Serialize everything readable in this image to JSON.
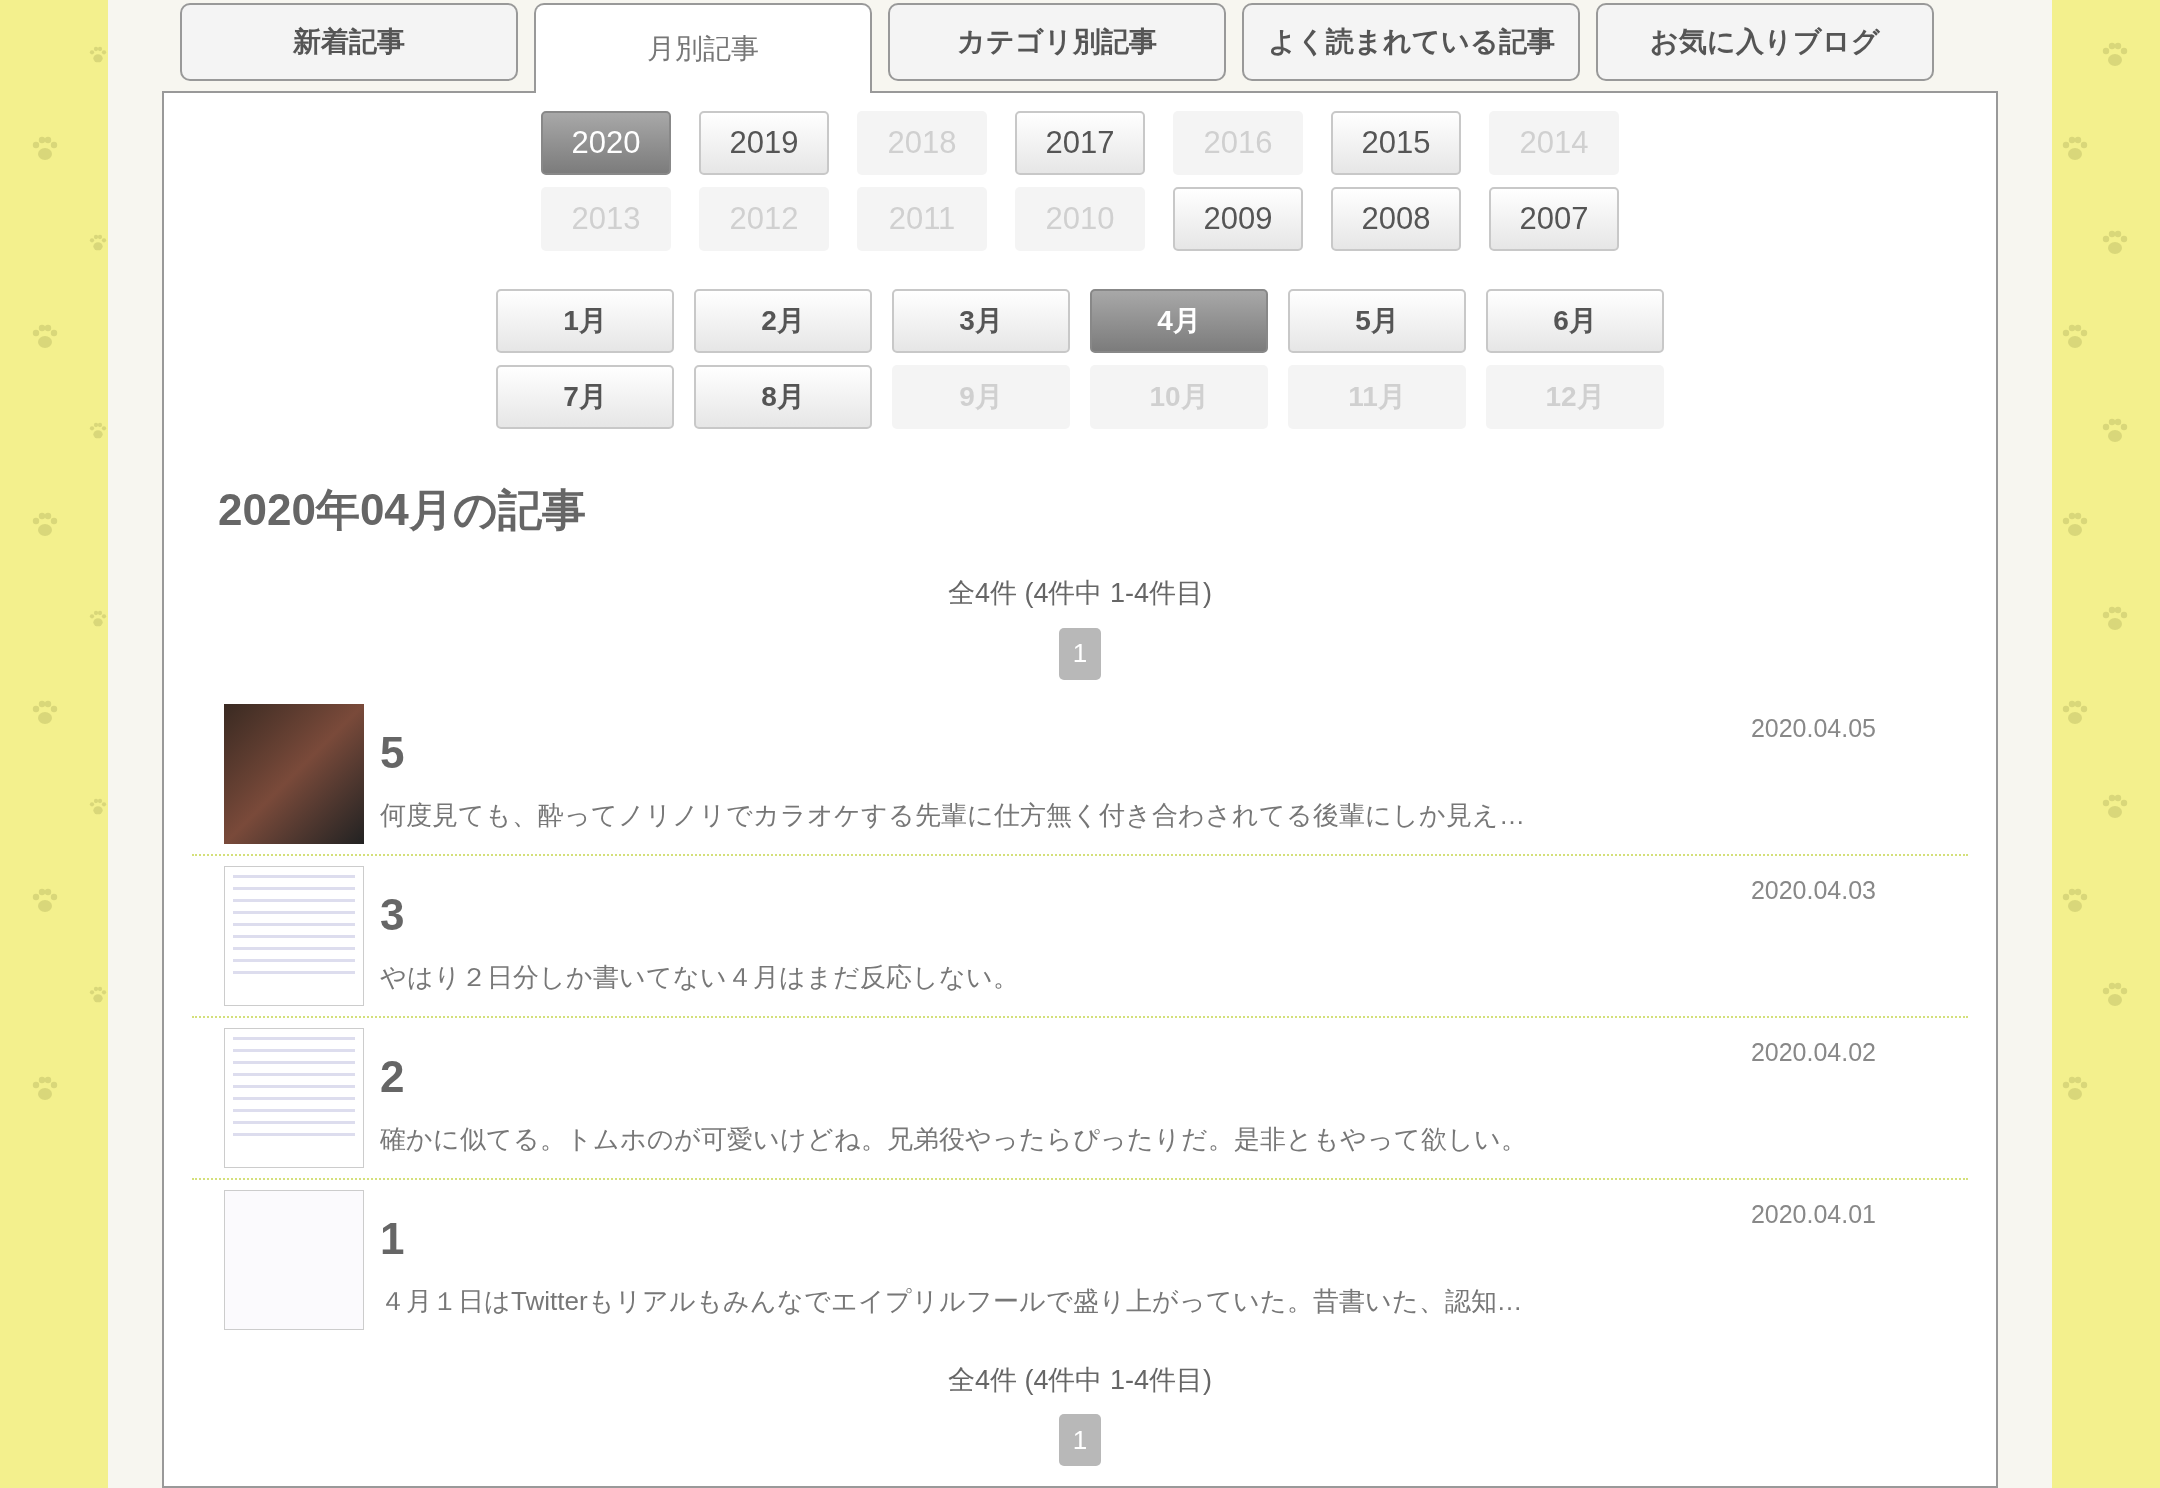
{
  "tabs": [
    {
      "label": "新着記事",
      "selected": false
    },
    {
      "label": "月別記事",
      "selected": true
    },
    {
      "label": "カテゴリ別記事",
      "selected": false
    },
    {
      "label": "よく読まれている記事",
      "selected": false
    },
    {
      "label": "お気に入りブログ",
      "selected": false
    }
  ],
  "years": [
    {
      "label": "2020",
      "selected": true,
      "disabled": false
    },
    {
      "label": "2019",
      "selected": false,
      "disabled": false
    },
    {
      "label": "2018",
      "selected": false,
      "disabled": true
    },
    {
      "label": "2017",
      "selected": false,
      "disabled": false
    },
    {
      "label": "2016",
      "selected": false,
      "disabled": true
    },
    {
      "label": "2015",
      "selected": false,
      "disabled": false
    },
    {
      "label": "2014",
      "selected": false,
      "disabled": true
    },
    {
      "label": "2013",
      "selected": false,
      "disabled": true
    },
    {
      "label": "2012",
      "selected": false,
      "disabled": true
    },
    {
      "label": "2011",
      "selected": false,
      "disabled": true
    },
    {
      "label": "2010",
      "selected": false,
      "disabled": true
    },
    {
      "label": "2009",
      "selected": false,
      "disabled": false
    },
    {
      "label": "2008",
      "selected": false,
      "disabled": false
    },
    {
      "label": "2007",
      "selected": false,
      "disabled": false
    }
  ],
  "months": [
    {
      "label": "1月",
      "selected": false,
      "disabled": false
    },
    {
      "label": "2月",
      "selected": false,
      "disabled": false
    },
    {
      "label": "3月",
      "selected": false,
      "disabled": false
    },
    {
      "label": "4月",
      "selected": true,
      "disabled": false
    },
    {
      "label": "5月",
      "selected": false,
      "disabled": false
    },
    {
      "label": "6月",
      "selected": false,
      "disabled": false
    },
    {
      "label": "7月",
      "selected": false,
      "disabled": false
    },
    {
      "label": "8月",
      "selected": false,
      "disabled": false
    },
    {
      "label": "9月",
      "selected": false,
      "disabled": true
    },
    {
      "label": "10月",
      "selected": false,
      "disabled": true
    },
    {
      "label": "11月",
      "selected": false,
      "disabled": true
    },
    {
      "label": "12月",
      "selected": false,
      "disabled": true
    }
  ],
  "heading": "2020年04月の記事",
  "pager_top": {
    "summary": "全4件 (4件中 1-4件目)",
    "pages": [
      {
        "label": "1",
        "selected": true
      }
    ]
  },
  "articles": [
    {
      "kind": "photo",
      "title": "5",
      "date": "2020.04.05",
      "excerpt": "何度見ても、酔ってノリノリでカラオケする先輩に仕方無く付き合わされてる後輩にしか見え…"
    },
    {
      "kind": "screenshot",
      "title": "3",
      "date": "2020.04.03",
      "excerpt": "やはり２日分しか書いてない４月はまだ反応しない。"
    },
    {
      "kind": "screenshot",
      "title": "2",
      "date": "2020.04.02",
      "excerpt": "確かに似てる。トムホのが可愛いけどね。兄弟役やったらぴったりだ。是非ともやって欲しい。"
    },
    {
      "kind": "sketch",
      "title": "1",
      "date": "2020.04.01",
      "excerpt": "４月１日はTwitterもリアルもみんなでエイプリルフールで盛り上がっていた。昔書いた、認知…"
    }
  ],
  "pager_bottom": {
    "summary": "全4件 (4件中 1-4件目)",
    "pages": [
      {
        "label": "1",
        "selected": true
      }
    ]
  }
}
